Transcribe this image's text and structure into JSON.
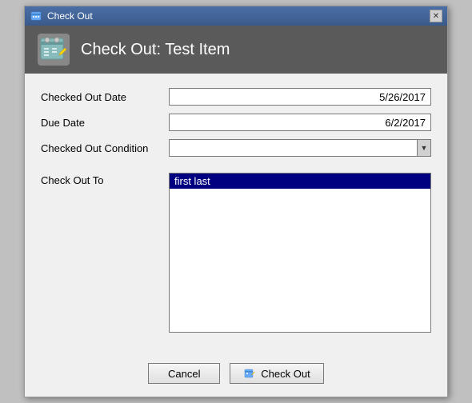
{
  "window": {
    "title": "Check Out",
    "header_title": "Check Out: Test Item"
  },
  "form": {
    "checked_out_date_label": "Checked Out Date",
    "checked_out_date_value": "5/26/2017",
    "due_date_label": "Due Date",
    "due_date_value": "6/2/2017",
    "checked_out_condition_label": "Checked Out Condition",
    "checked_out_condition_value": "",
    "check_out_to_label": "Check Out To",
    "check_out_to_selected": "first last"
  },
  "buttons": {
    "cancel_label": "Cancel",
    "checkout_label": "Check Out"
  },
  "icons": {
    "window_icon": "📅",
    "header_icon": "📋",
    "checkout_button_icon": "📋"
  }
}
